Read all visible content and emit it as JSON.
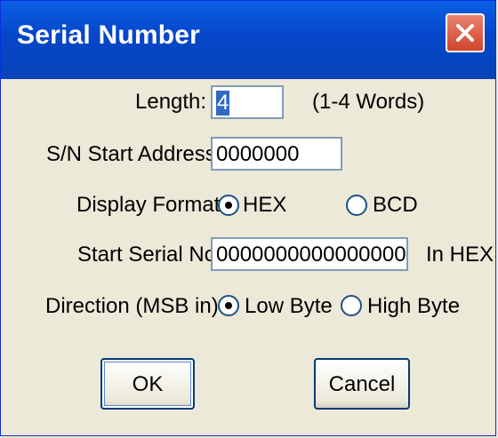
{
  "window": {
    "title": "Serial Number",
    "close_icon": "close-icon"
  },
  "form": {
    "length_label": "Length:",
    "length_value": "4",
    "length_hint": "(1-4 Words)",
    "start_address_label": "S/N Start Address:",
    "start_address_value": "0000000",
    "display_format_label": "Display Format:",
    "display_format_options": [
      "HEX",
      "BCD"
    ],
    "display_format_selected": "HEX",
    "start_serial_label": "Start Serial No.:",
    "start_serial_value": "0000000000000000",
    "start_serial_suffix": "In HEX",
    "direction_label": "Direction (MSB in):",
    "direction_options": [
      "Low Byte",
      "High Byte"
    ],
    "direction_selected": "Low Byte"
  },
  "buttons": {
    "ok_label": "OK",
    "cancel_label": "Cancel"
  },
  "colors": {
    "titlebar": "#0646c9",
    "close_button": "#d2452c",
    "dialog_background": "#ece9d8",
    "field_border": "#7f9db9",
    "selection": "#316ac5"
  }
}
